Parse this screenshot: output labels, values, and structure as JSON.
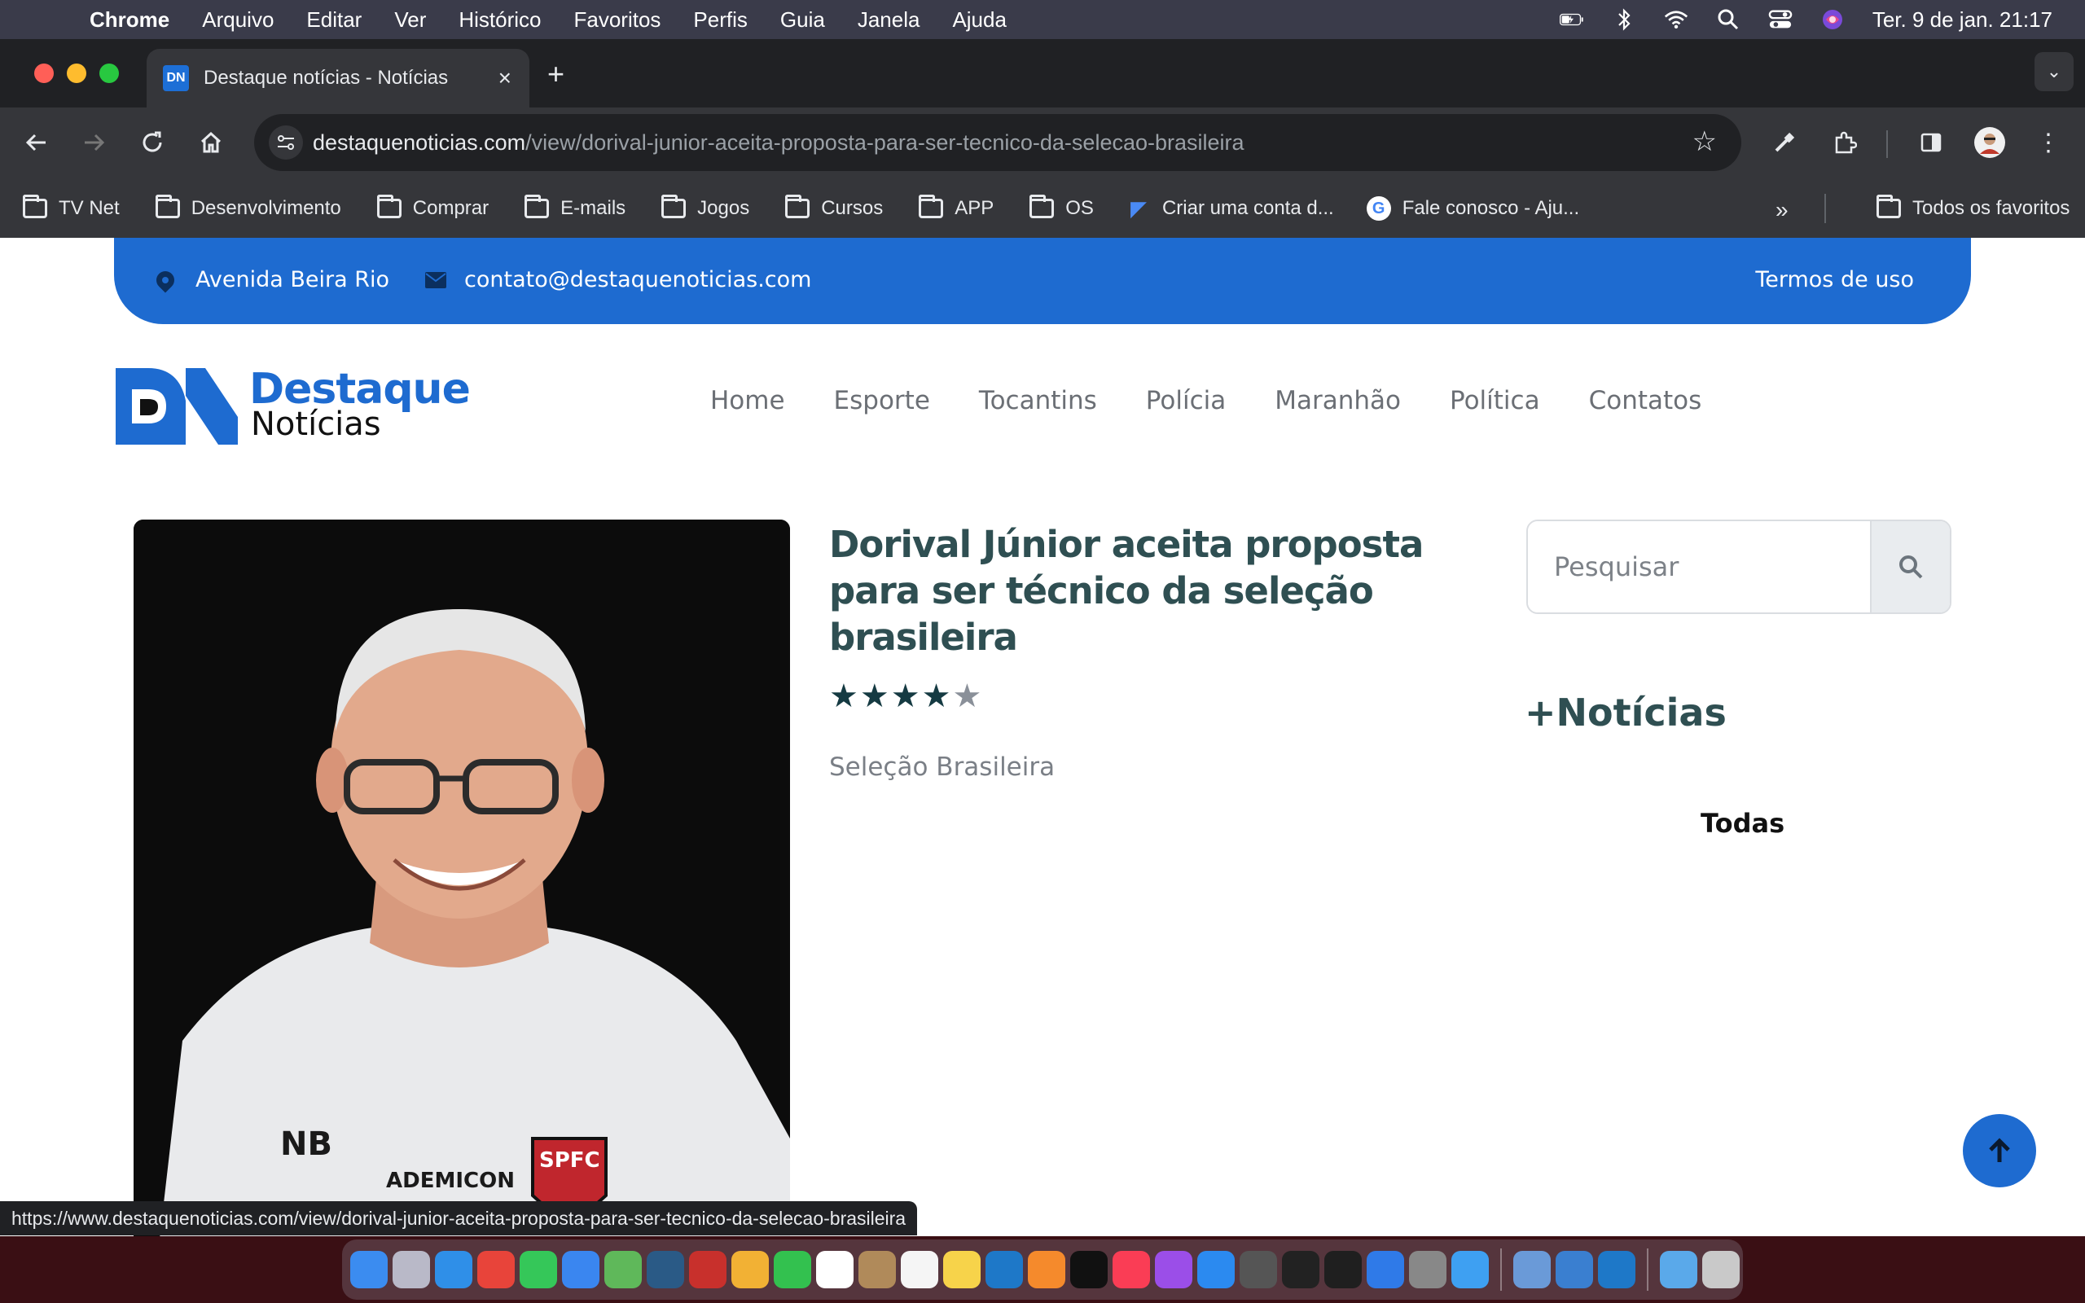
{
  "menubar": {
    "app": "Chrome",
    "items": [
      "Arquivo",
      "Editar",
      "Ver",
      "Histórico",
      "Favoritos",
      "Perfis",
      "Guia",
      "Janela",
      "Ajuda"
    ],
    "clock": "Ter. 9 de jan.  21:17"
  },
  "browser": {
    "tab_title": "Destaque notícias - Notícias",
    "url_domain": "destaquenoticias.com",
    "url_path": "/view/dorival-junior-aceita-proposta-para-ser-tecnico-da-selecao-brasileira",
    "bookmarks": [
      "TV Net",
      "Desenvolvimento",
      "Comprar",
      "E-mails",
      "Jogos",
      "Cursos",
      "APP",
      "OS",
      "Criar uma conta d...",
      "Fale conosco - Aju..."
    ],
    "bookmarks_all": "Todos os favoritos",
    "status_url": "https://www.destaquenoticias.com/view/dorival-junior-aceita-proposta-para-ser-tecnico-da-selecao-brasileira"
  },
  "site": {
    "topbar": {
      "address": "Avenida Beira Rio",
      "email": "contato@destaquenoticias.com",
      "terms": "Termos de uso"
    },
    "logo": {
      "line1": "Destaque",
      "line2": "Notícias"
    },
    "nav": [
      "Home",
      "Esporte",
      "Tocantins",
      "Polícia",
      "Maranhão",
      "Política",
      "Contatos"
    ],
    "article": {
      "title": "Dorival Júnior aceita proposta para ser técnico da seleção brasileira",
      "rating": 4,
      "rating_max": 5,
      "category": "Seleção Brasileira"
    },
    "sidebar": {
      "search_placeholder": "Pesquisar",
      "more_news": "+Notícias",
      "filter_all": "Todas"
    }
  },
  "colors": {
    "brand_blue": "#1e6bd0",
    "title_teal": "#2f4f52",
    "star_on": "#153a42"
  }
}
